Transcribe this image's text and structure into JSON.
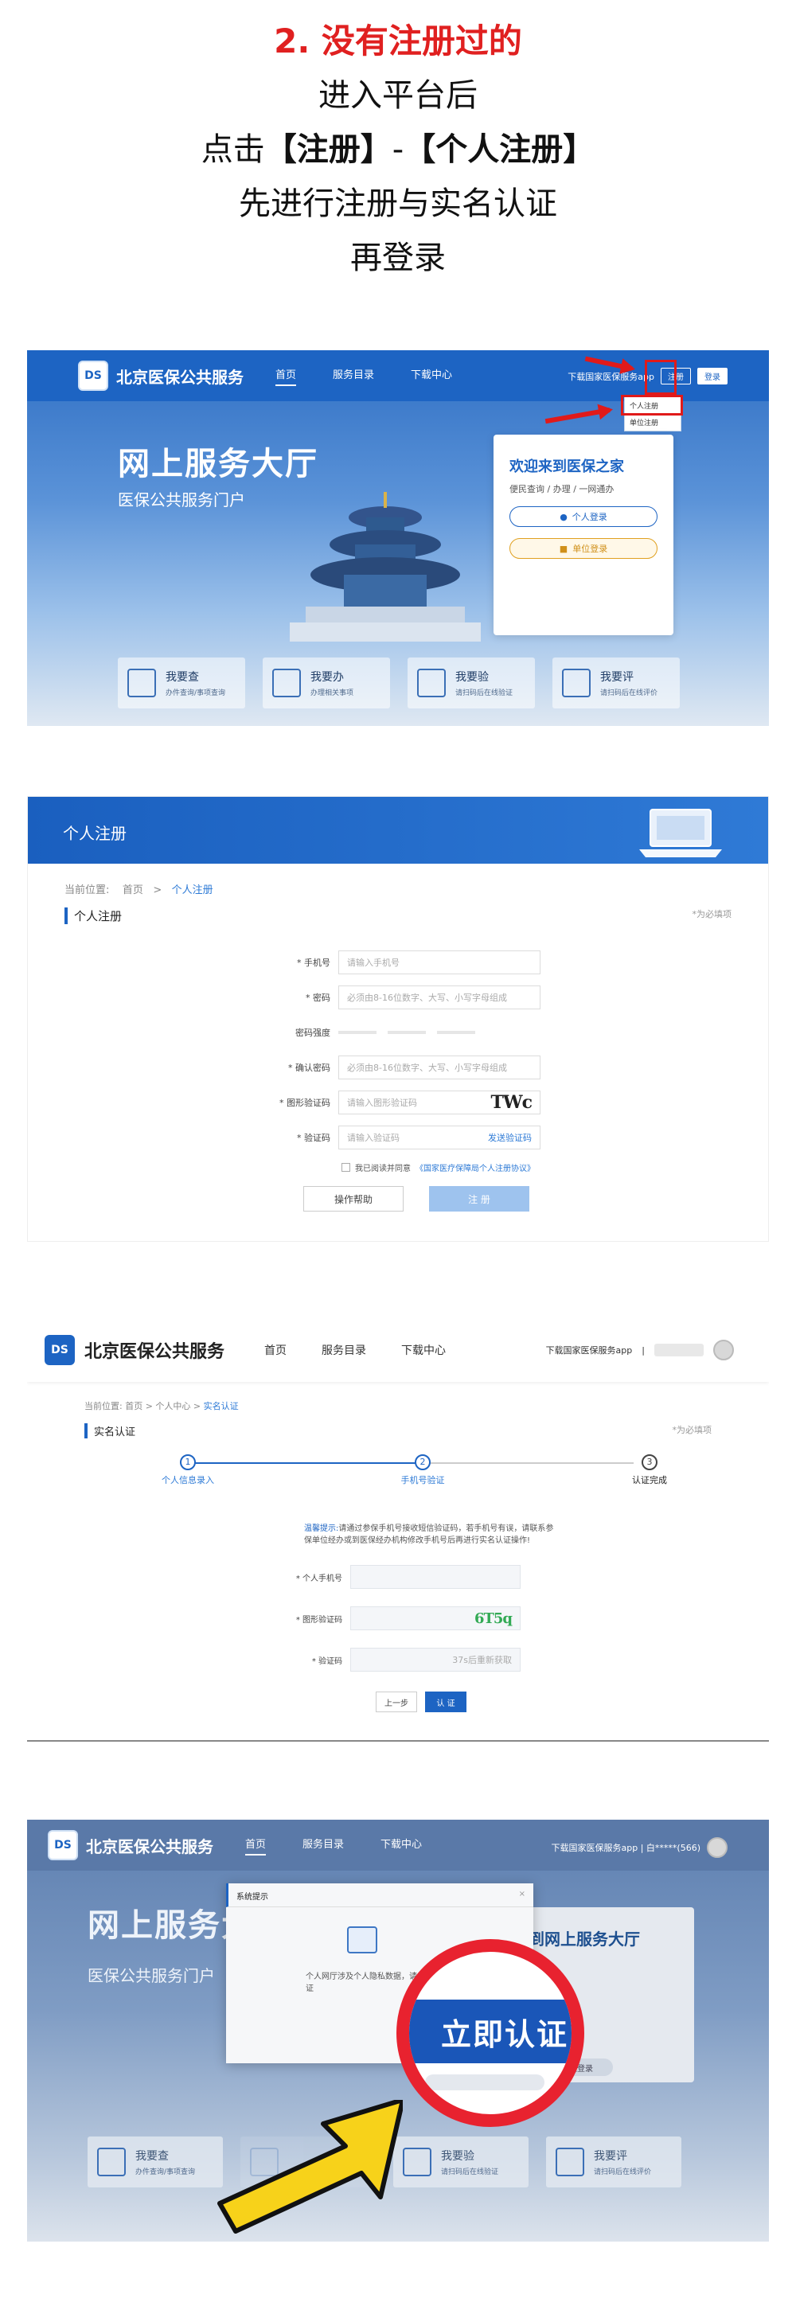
{
  "intro": {
    "heading": "2. 没有注册过的",
    "line1": "进入平台后",
    "line2_prefix": "点击",
    "line2_bold1": "【注册】",
    "line2_mid": "-",
    "line2_bold2": "【个人注册】",
    "line3": "先进行注册与实名认证",
    "line4": "再登录"
  },
  "shot1": {
    "logo_text": "DS",
    "brand": "北京医保公共服务",
    "nav": [
      "首页",
      "服务目录",
      "下载中心"
    ],
    "download_app": "下载国家医保服务app",
    "register_button": "注册",
    "login_button": "登录",
    "dropdown": [
      "个人注册",
      "单位注册"
    ],
    "hero_title": "网上服务大厅",
    "hero_sub": "医保公共服务门户",
    "welcome_title": "欢迎来到医保之家",
    "welcome_desc": "便民查询 / 办理 / 一网通办",
    "personal_login": "个人登录",
    "unit_login": "单位登录",
    "tiles": [
      {
        "title": "我要查",
        "desc": "办件查询/事项查询",
        "icon": "eye-icon"
      },
      {
        "title": "我要办",
        "desc": "办理相关事项",
        "icon": "stamp-icon"
      },
      {
        "title": "我要验",
        "desc": "请扫码后在线验证",
        "icon": "star-badge-icon"
      },
      {
        "title": "我要评",
        "desc": "请扫码后在线评价",
        "icon": "pen-icon"
      }
    ]
  },
  "shot2": {
    "banner_title": "个人注册",
    "crumb_label": "当前位置:",
    "crumb_home": "首页",
    "crumb_sep": ">",
    "crumb_current": "个人注册",
    "section_title": "个人注册",
    "required_note": "*为必填项",
    "fields": {
      "phone_label": "* 手机号",
      "phone_placeholder": "请输入手机号",
      "password_label": "* 密码",
      "password_placeholder": "必须由8-16位数字、大写、小写字母组成",
      "strength_label": "密码强度",
      "confirm_label": "* 确认密码",
      "confirm_placeholder": "必须由8-16位数字、大写、小写字母组成",
      "captcha_label": "* 图形验证码",
      "captcha_placeholder": "请输入图形验证码",
      "captcha_image": "TWc",
      "code_label": "* 验证码",
      "code_placeholder": "请输入验证码",
      "code_link": "发送验证码"
    },
    "agree_text": "我已阅读并同意",
    "agree_link": "《国家医疗保障局个人注册协议》",
    "help_button": "操作帮助",
    "submit_button": "注 册"
  },
  "shot3": {
    "logo_text": "DS",
    "brand": "北京医保公共服务",
    "nav": [
      "首页",
      "服务目录",
      "下载中心"
    ],
    "download_app": "下载国家医保服务app",
    "divider": "|",
    "crumb": "当前位置: 首页 > 个人中心 > ",
    "crumb_current": "实名认证",
    "section_title": "实名认证",
    "required_note": "*为必填项",
    "steps": [
      {
        "num": "1",
        "label": "个人信息录入"
      },
      {
        "num": "2",
        "label": "手机号验证"
      },
      {
        "num": "3",
        "label": "认证完成"
      }
    ],
    "tip_title": "温馨提示:",
    "tip_text": "请通过参保手机号接收短信验证码，若手机号有误，请联系参保单位经办或到医保经办机构修改手机号后再进行实名认证操作!",
    "phone_label": "* 个人手机号",
    "captcha_label": "* 图形验证码",
    "captcha_image": "6T5q",
    "code_label": "* 验证码",
    "code_resend": "37s后重新获取",
    "prev_button": "上一步",
    "auth_button": "认 证"
  },
  "shot4": {
    "logo_text": "DS",
    "brand": "北京医保公共服务",
    "nav": [
      "首页",
      "服务目录",
      "下载中心"
    ],
    "download_app": "下载国家医保服务app | 白*****(566)",
    "hero_title": "网上服务大",
    "hero_sub": "医保公共服务门户",
    "welcome_title": "迎来到网上服务大厅",
    "card_button": "单位登录",
    "dialog_title": "系统提示",
    "dialog_close": "×",
    "dialog_text": "个人网厅涉及个人隐私数据，请先完成实名认证",
    "cta": "立即认证",
    "tiles": [
      {
        "title": "我要查",
        "desc": "办件查询/事项查询"
      },
      {
        "title": "",
        "desc": ""
      },
      {
        "title": "我要验",
        "desc": "请扫码后在线验证"
      },
      {
        "title": "我要评",
        "desc": "请扫码后在线评价"
      }
    ]
  }
}
